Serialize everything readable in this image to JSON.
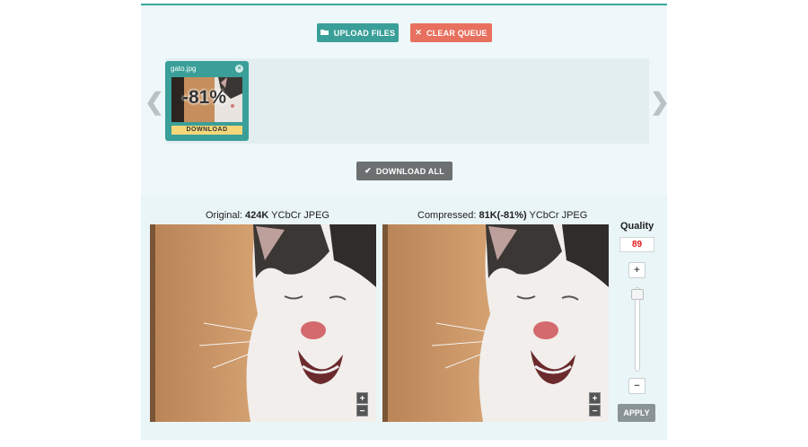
{
  "toolbar": {
    "upload_label": "UPLOAD FILES",
    "clear_label": "CLEAR QUEUE",
    "download_all_label": "DOWNLOAD ALL"
  },
  "queue": {
    "prev_arrow": "❮",
    "next_arrow": "❯",
    "files": [
      {
        "name": "gato.jpg",
        "reduction": "-81%",
        "download_label": "DOWNLOAD",
        "close": "×"
      }
    ]
  },
  "compare": {
    "original": {
      "prefix": "Original: ",
      "size": "424K",
      "suffix": " YCbCr JPEG"
    },
    "compressed": {
      "prefix": "Compressed: ",
      "size": "81K(-81%)",
      "suffix": " YCbCr JPEG"
    },
    "zoom_in": "+",
    "zoom_out": "−"
  },
  "quality": {
    "label": "Quality",
    "value": "89",
    "plus": "+",
    "minus": "−",
    "apply_label": "APPLY",
    "slider_level": 0.89
  },
  "icons": {
    "upload": "folder-open-icon",
    "clear": "close-icon",
    "download_all": "check-icon"
  },
  "colors": {
    "accent": "#3a9f98",
    "danger": "#e8705f",
    "quality_value": "#e01919",
    "download_badge": "#f4d77a"
  }
}
